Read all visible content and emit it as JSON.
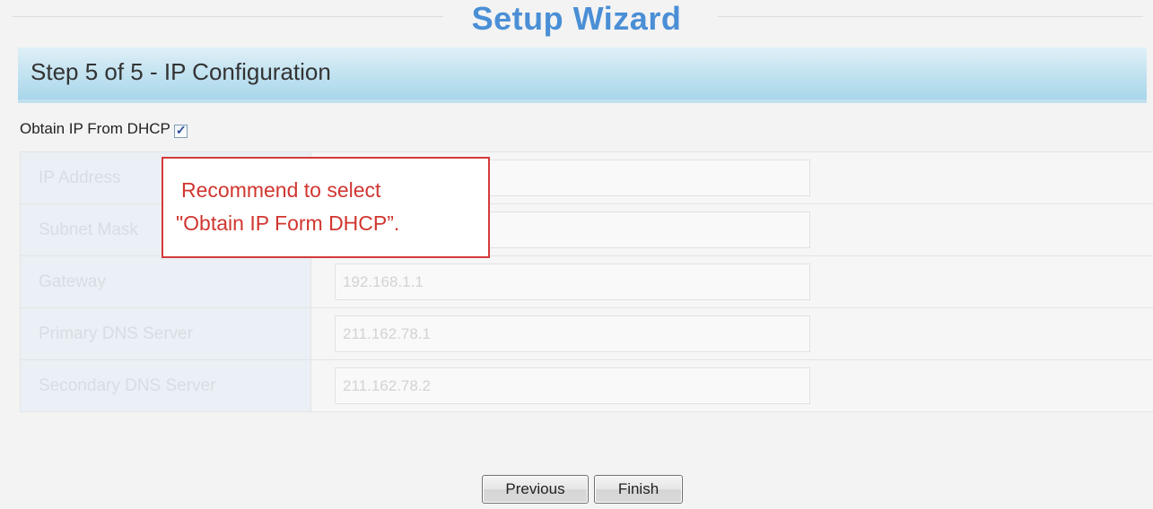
{
  "wizard": {
    "title": "Setup Wizard",
    "step_title": "Step 5 of 5 - IP Configuration"
  },
  "dhcp": {
    "label": "Obtain IP From DHCP",
    "checked": true
  },
  "ip_fields": [
    {
      "label": "IP Address",
      "value": ""
    },
    {
      "label": "Subnet Mask",
      "value": ""
    },
    {
      "label": "Gateway",
      "value": "192.168.1.1"
    },
    {
      "label": "Primary DNS Server",
      "value": "211.162.78.1"
    },
    {
      "label": "Secondary DNS Server",
      "value": "211.162.78.2"
    }
  ],
  "callout": {
    "line1": "Recommend to select",
    "line2": "\"Obtain IP Form DHCP”."
  },
  "buttons": {
    "previous": "Previous",
    "finish": "Finish"
  },
  "colors": {
    "title": "#4a8fd6",
    "callout_border": "#d43a3a",
    "callout_text": "#d0362f"
  }
}
